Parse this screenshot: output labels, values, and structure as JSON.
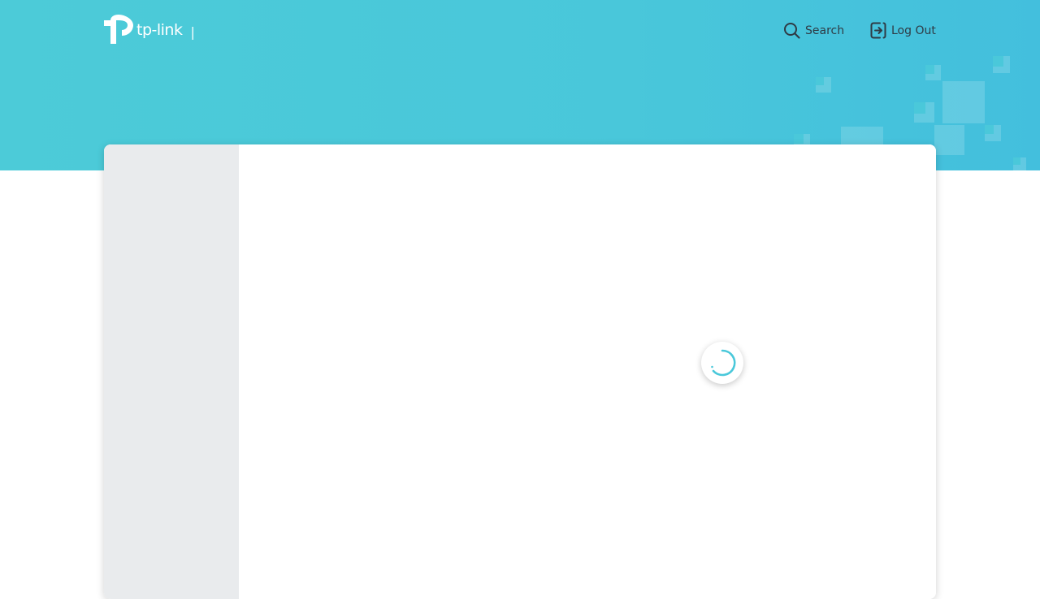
{
  "brand": {
    "logo_text": "tp-link",
    "divider": "|",
    "accent_color": "#4ac8da"
  },
  "header": {
    "search_label": "Search",
    "search_icon": "search-icon",
    "logout_label": "Log Out",
    "logout_icon": "logout-icon"
  },
  "main": {
    "status": "loading",
    "spinner_color": "#4ac8da"
  }
}
